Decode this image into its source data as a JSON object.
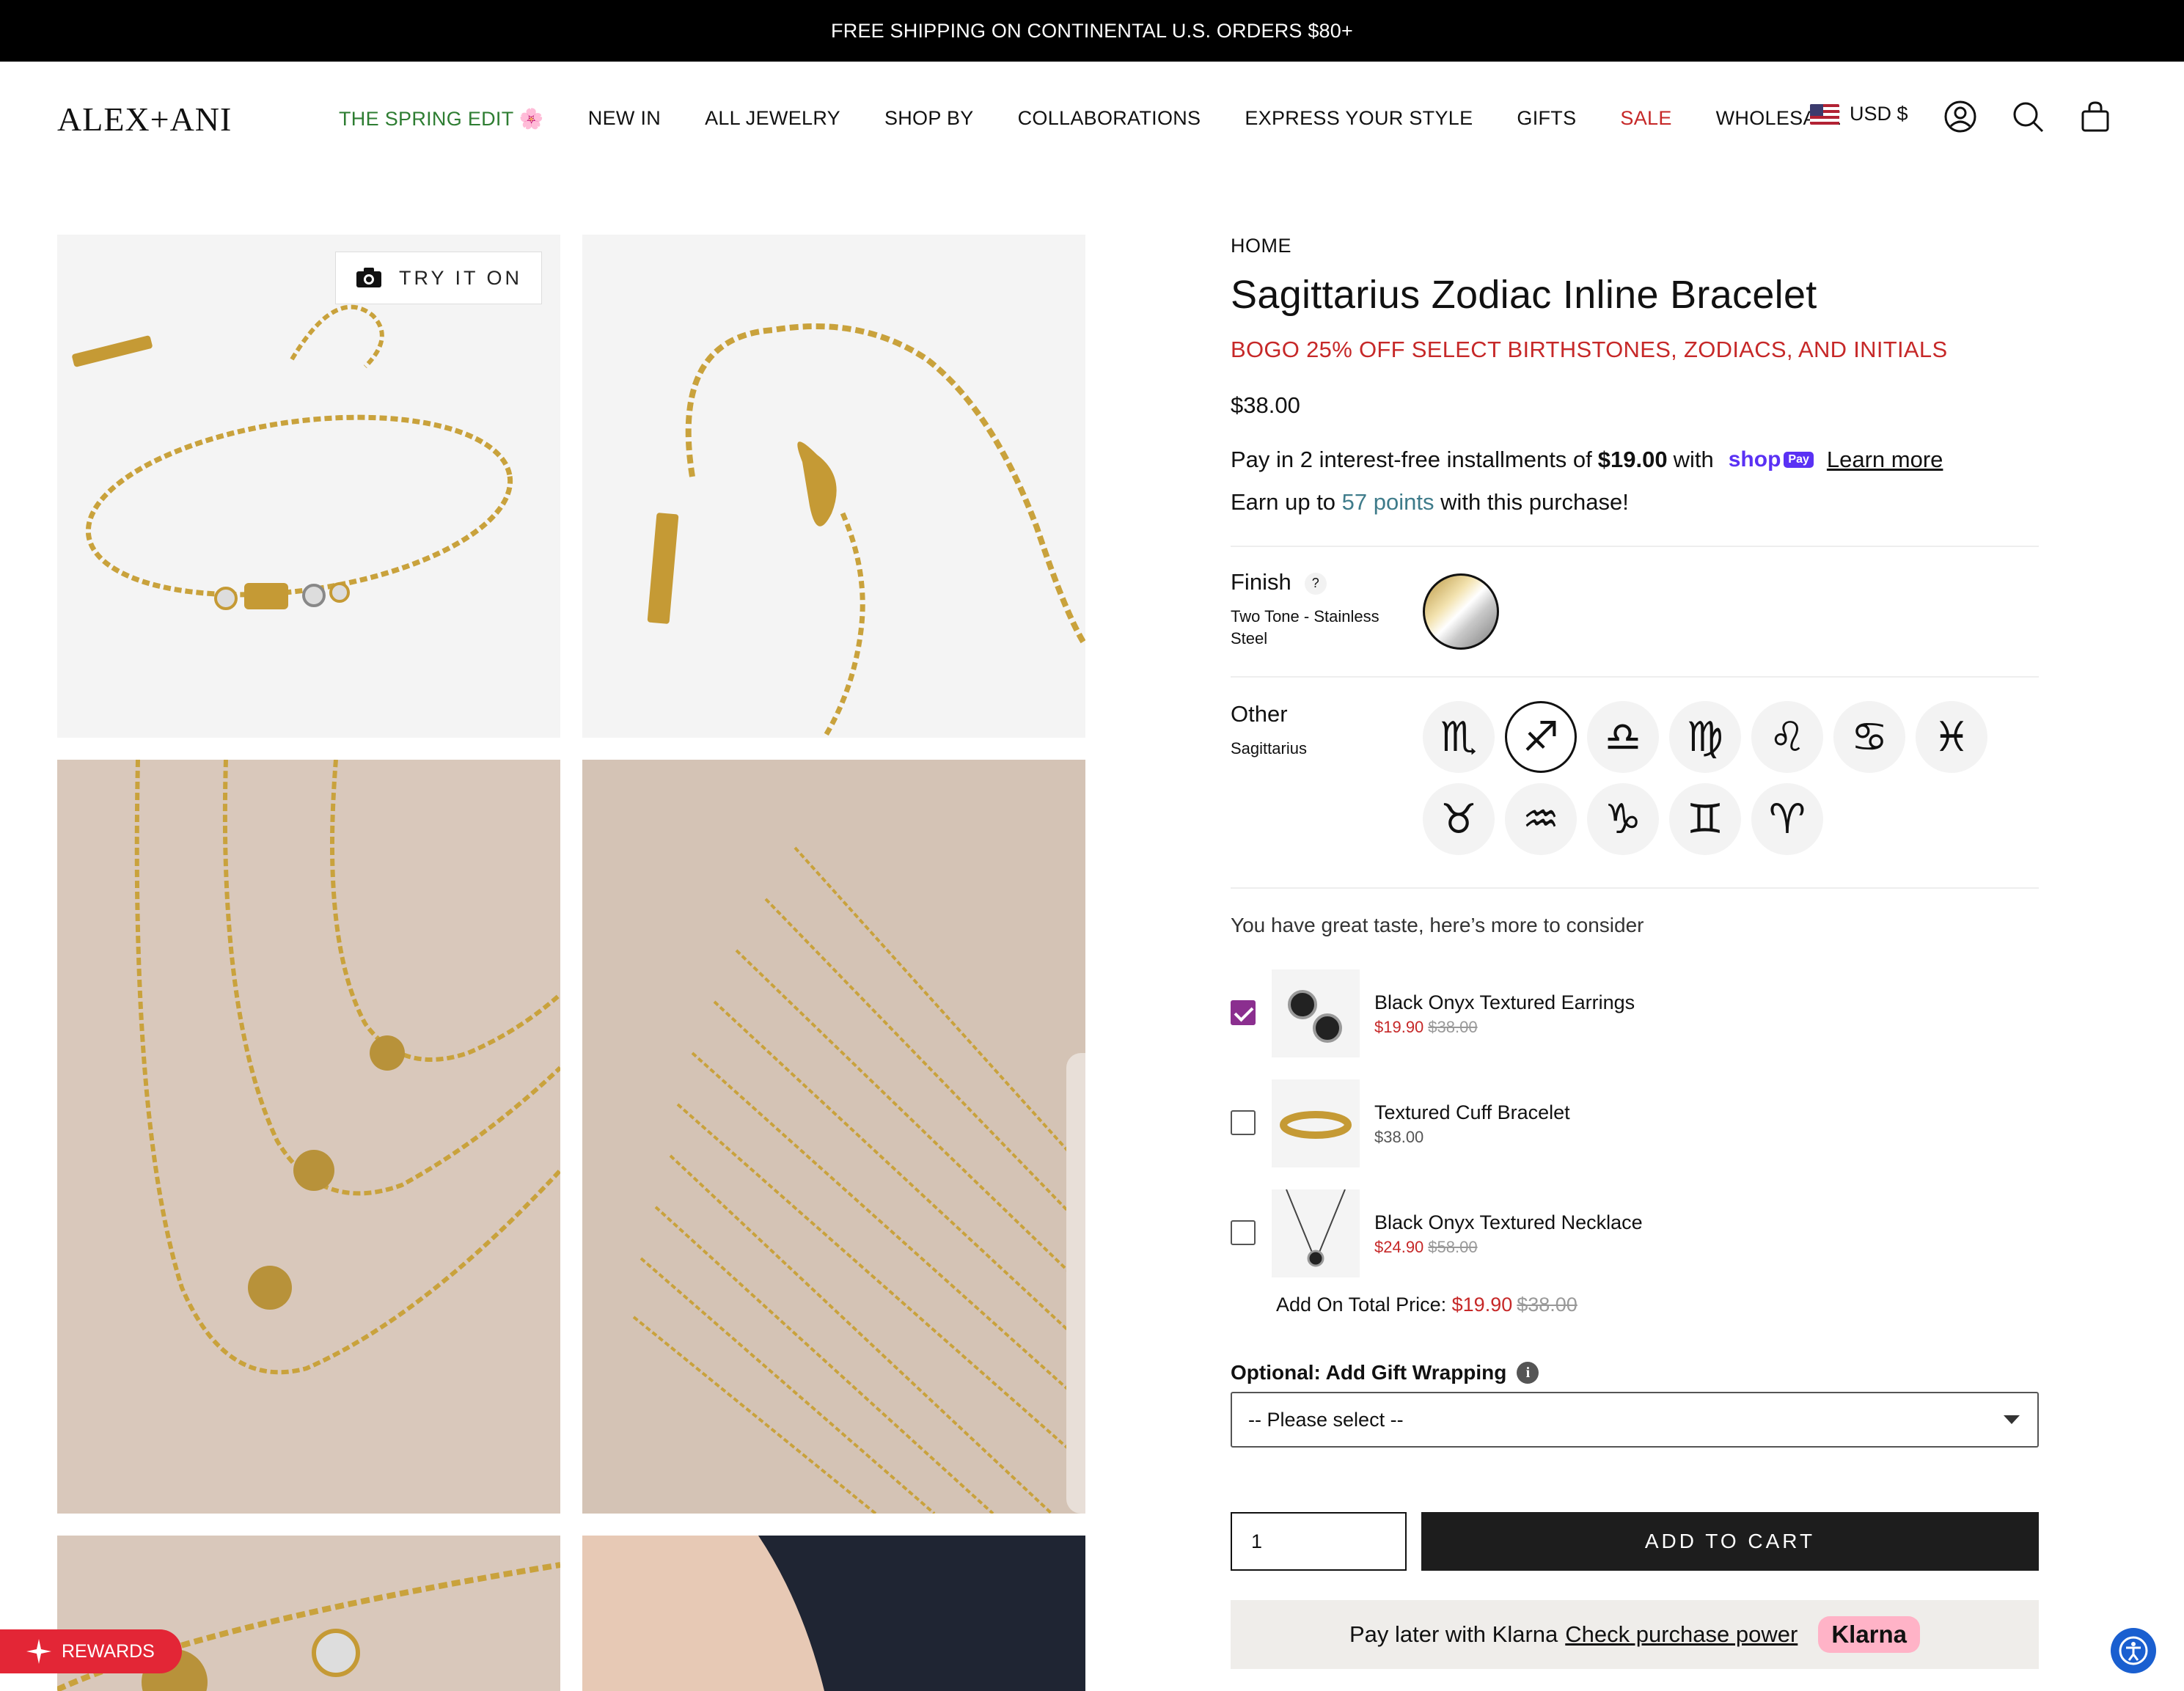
{
  "announcement": "FREE SHIPPING ON CONTINENTAL U.S. ORDERS $80+",
  "header": {
    "logo": "ALEX+ANI",
    "nav": [
      {
        "label": "THE SPRING EDIT 🌸",
        "style": "spring"
      },
      {
        "label": "NEW IN",
        "style": ""
      },
      {
        "label": "ALL JEWELRY",
        "style": ""
      },
      {
        "label": "SHOP BY",
        "style": ""
      },
      {
        "label": "COLLABORATIONS",
        "style": ""
      },
      {
        "label": "EXPRESS YOUR STYLE",
        "style": ""
      },
      {
        "label": "GIFTS",
        "style": ""
      },
      {
        "label": "SALE",
        "style": "sale"
      },
      {
        "label": "WHOLESALE",
        "style": ""
      }
    ],
    "currency": "USD $",
    "icons": [
      "account-icon",
      "search-icon",
      "cart-icon"
    ]
  },
  "gallery": {
    "try_on_label": "TRY IT ON"
  },
  "product": {
    "breadcrumb": "HOME",
    "title": "Sagittarius Zodiac Inline Bracelet",
    "promo": "BOGO 25% OFF SELECT BIRTHSTONES, ZODIACS, AND INITIALS",
    "price": "$38.00",
    "installments_prefix": "Pay in 2 interest-free installments of",
    "installment_amount": "$19.00",
    "installments_suffix": "with",
    "shop_pay_word": "shop",
    "shop_pay_badge": "Pay",
    "learn_more": "Learn more",
    "points_prefix": "Earn up to",
    "points_value": "57 points",
    "points_suffix": "with this purchase!",
    "finish": {
      "label": "Finish",
      "help": "?",
      "value": "Two Tone - Stainless Steel"
    },
    "other": {
      "label": "Other",
      "value": "Sagittarius",
      "signs": [
        {
          "symbol": "♏",
          "selected": false
        },
        {
          "symbol": "♐",
          "selected": true
        },
        {
          "symbol": "♎",
          "selected": false
        },
        {
          "symbol": "♍",
          "selected": false
        },
        {
          "symbol": "♌",
          "selected": false
        },
        {
          "symbol": "♋",
          "selected": false
        },
        {
          "symbol": "♓",
          "selected": false
        },
        {
          "symbol": "♉",
          "selected": false
        },
        {
          "symbol": "♒",
          "selected": false
        },
        {
          "symbol": "♑",
          "selected": false
        },
        {
          "symbol": "♊",
          "selected": false
        },
        {
          "symbol": "♈",
          "selected": false
        }
      ]
    }
  },
  "addons": {
    "heading": "You have great taste, here’s more to consider",
    "items": [
      {
        "name": "Black Onyx Textured Earrings",
        "price": "$19.90",
        "was": "$38.00",
        "checked": true
      },
      {
        "name": "Textured Cuff Bracelet",
        "price": "$38.00",
        "was": "",
        "checked": false
      },
      {
        "name": "Black Onyx Textured Necklace",
        "price": "$24.90",
        "was": "$58.00",
        "checked": false
      }
    ],
    "total_label": "Add On Total Price:",
    "total_price": "$19.90",
    "total_was": "$38.00"
  },
  "gift_wrap": {
    "label": "Optional: Add Gift Wrapping",
    "info": "i",
    "selected": "-- Please select --"
  },
  "purchase": {
    "quantity": "1",
    "add_to_cart": "ADD TO CART"
  },
  "klarna": {
    "prefix": "Pay later with Klarna",
    "link": "Check purchase power",
    "logo": "Klarna"
  },
  "rewards_label": "REWARDS",
  "colors": {
    "sale_red": "#c62828",
    "spring_green": "#2e7d32",
    "checkbox_purple": "#8b2f8f",
    "points_teal": "#3e7b8a",
    "shop_pay": "#5a31f4",
    "klarna_pink": "#ffb3c7"
  }
}
